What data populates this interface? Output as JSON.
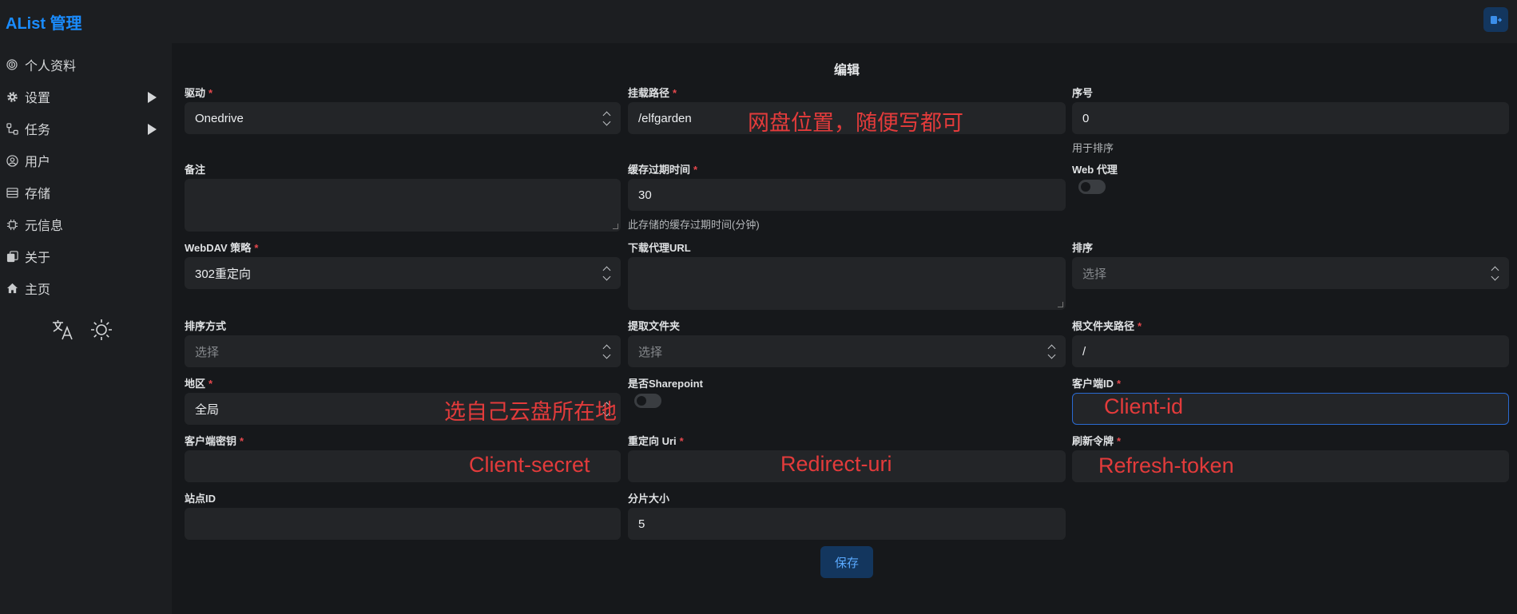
{
  "app": {
    "title": "AList 管理"
  },
  "sidebar": {
    "items": [
      {
        "label": "个人资料",
        "icon": "fingerprint-icon"
      },
      {
        "label": "设置",
        "icon": "gear-icon"
      },
      {
        "label": "任务",
        "icon": "tasks-icon"
      },
      {
        "label": "用户",
        "icon": "user-icon"
      },
      {
        "label": "存储",
        "icon": "storage-icon"
      },
      {
        "label": "元信息",
        "icon": "metadata-icon"
      },
      {
        "label": "关于",
        "icon": "copy-icon"
      },
      {
        "label": "主页",
        "icon": "home-icon"
      }
    ]
  },
  "form": {
    "title": "编辑",
    "driver": {
      "label": "驱动",
      "value": "Onedrive"
    },
    "mount_path": {
      "label": "挂载路径",
      "value": "/elfgarden"
    },
    "order": {
      "label": "序号",
      "value": "0",
      "help": "用于排序"
    },
    "remark": {
      "label": "备注",
      "value": ""
    },
    "cache_expiration": {
      "label": "缓存过期时间",
      "value": "30",
      "help": "此存储的缓存过期时间(分钟)"
    },
    "web_proxy": {
      "label": "Web 代理",
      "enabled": false
    },
    "webdav_policy": {
      "label": "WebDAV 策略",
      "value": "302重定向"
    },
    "down_proxy_url": {
      "label": "下载代理URL",
      "value": ""
    },
    "order_by": {
      "label": "排序",
      "placeholder": "选择"
    },
    "order_direction": {
      "label": "排序方式",
      "placeholder": "选择"
    },
    "extract_folder": {
      "label": "提取文件夹",
      "placeholder": "选择"
    },
    "root_folder_path": {
      "label": "根文件夹路径",
      "value": "/"
    },
    "region": {
      "label": "地区",
      "value": "全局"
    },
    "is_sharepoint": {
      "label": "是否Sharepoint",
      "enabled": false
    },
    "client_id": {
      "label": "客户端ID",
      "value": ""
    },
    "client_secret": {
      "label": "客户端密钥",
      "value": ""
    },
    "redirect_uri": {
      "label": "重定向 Uri",
      "value": ""
    },
    "refresh_token": {
      "label": "刷新令牌",
      "value": ""
    },
    "site_id": {
      "label": "站点ID",
      "value": ""
    },
    "chunk_size": {
      "label": "分片大小",
      "value": "5"
    },
    "required_mark": "*",
    "save_label": "保存"
  },
  "annotations": {
    "mount_path": "网盘位置，随便写都可",
    "region": "选自己云盘所在地",
    "client_id": "Client-id",
    "client_secret": "Client-secret",
    "redirect_uri": "Redirect-uri",
    "refresh_token": "Refresh-token"
  },
  "colors": {
    "accent": "#1a8cff",
    "required": "#e5484d",
    "annotation": "#e33b3b",
    "button_bg": "#13365e"
  }
}
